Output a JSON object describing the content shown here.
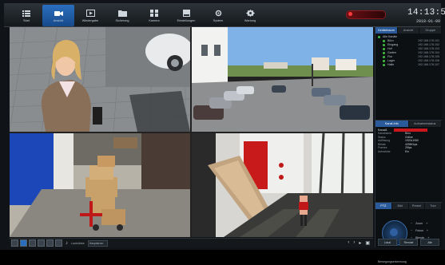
{
  "nav": {
    "items": [
      {
        "label": "Start",
        "icon": "menu-icon"
      },
      {
        "label": "Ansicht",
        "icon": "live-camera-icon"
      },
      {
        "label": "Wiedergabe",
        "icon": "playback-icon"
      },
      {
        "label": "Sicherung",
        "icon": "folder-icon"
      },
      {
        "label": "Kamera",
        "icon": "camera-settings-icon"
      },
      {
        "label": "Einstellungen",
        "icon": "storage-icon"
      },
      {
        "label": "System",
        "icon": "system-icon"
      },
      {
        "label": "Wartung",
        "icon": "gear-icon"
      }
    ],
    "active_index": 1
  },
  "status": {
    "time": "14:13:58",
    "date": "2018-01-09"
  },
  "accent_color": "#2a6fbf",
  "panel": {
    "tabs": [
      "Gerätebaum",
      "Ansicht",
      "Gruppe"
    ],
    "tree": [
      {
        "name": "Alle Kanäle",
        "ip": ""
      },
      {
        "name": "Büro",
        "ip": "192.168.178.101"
      },
      {
        "name": "Eingang",
        "ip": "192.168.178.102"
      },
      {
        "name": "Hof",
        "ip": "192.168.178.103"
      },
      {
        "name": "Garten",
        "ip": "192.168.178.104"
      },
      {
        "name": "Flur",
        "ip": "192.168.178.105"
      },
      {
        "name": "Lager",
        "ip": "192.168.178.106"
      },
      {
        "name": "Halle",
        "ip": "192.168.178.107"
      }
    ],
    "info_tabs": [
      "Kanal Info",
      "Aufnahmestatus"
    ],
    "info_title": "Kanal1",
    "info_rows": [
      {
        "k": "Kanalname",
        "v": "Büro"
      },
      {
        "k": "Status",
        "v": "Online"
      },
      {
        "k": "Auflösung",
        "v": "1920x1080"
      },
      {
        "k": "Bitrate",
        "v": "4096Kbps"
      },
      {
        "k": "Frames",
        "v": "25fps"
      },
      {
        "k": "Aufnahme",
        "v": "Ein"
      }
    ],
    "ptz_tabs": [
      "PTZ",
      "Bild",
      "Preset",
      "Tour"
    ],
    "ptz_controls": [
      "Zoom",
      "Fokus",
      "Blende"
    ],
    "bottom_link": "Bewegungserkennung",
    "buttons": [
      "Lokal",
      "Remote",
      "Alle"
    ]
  },
  "bottombar": {
    "layout_buttons": 6,
    "volume_label": "Lautstärke",
    "stream_select": "Hauptstrom"
  },
  "cameras": [
    {
      "name": "camera-1-woman-courtyard"
    },
    {
      "name": "camera-2-parking-lot"
    },
    {
      "name": "camera-3-warehouse"
    },
    {
      "name": "camera-4-hallway-door"
    }
  ]
}
